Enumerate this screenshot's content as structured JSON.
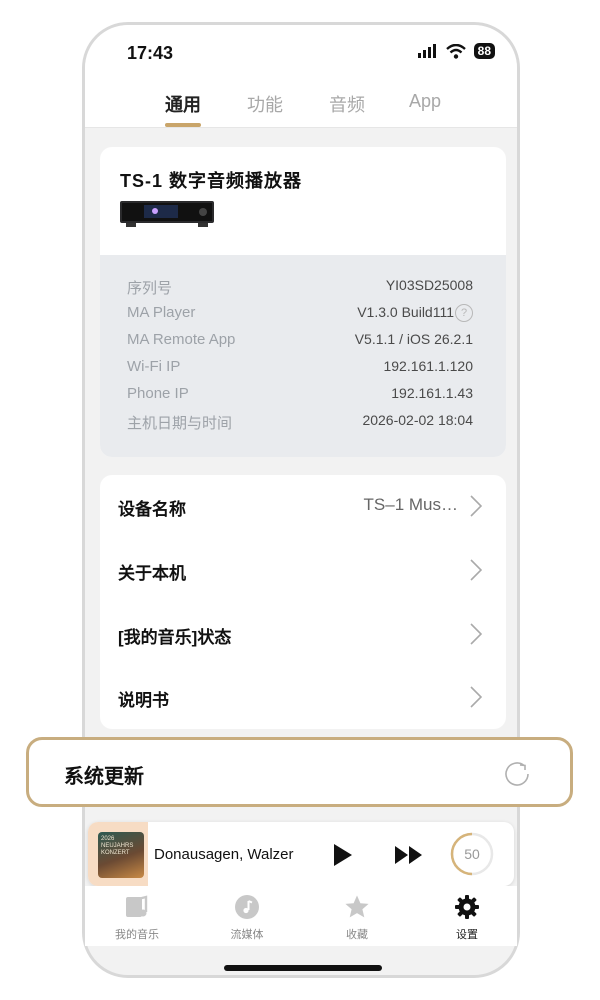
{
  "status_bar": {
    "time": "17:43",
    "battery": "88"
  },
  "tabs": [
    {
      "label": "通用",
      "active": true
    },
    {
      "label": "功能"
    },
    {
      "label": "音频"
    },
    {
      "label": "App"
    }
  ],
  "device": {
    "title": "TS-1 数字音频播放器",
    "info": [
      {
        "label": "序列号",
        "value": "YI03SD25008"
      },
      {
        "label": "MA Player",
        "value": "V1.3.0 Build111"
      },
      {
        "label": "MA Remote App",
        "value": "V5.1.1 / iOS 26.2.1"
      },
      {
        "label": "Wi-Fi IP",
        "value": "192.161.1.120"
      },
      {
        "label": "Phone IP",
        "value": "192.161.1.43"
      },
      {
        "label": "主机日期与时间",
        "value": "2026-02-02 18:04"
      }
    ]
  },
  "menu": [
    {
      "label": "设备名称",
      "value": "TS–1 Mus…"
    },
    {
      "label": "关于本机",
      "value": ""
    },
    {
      "label": "[我的音乐]状态",
      "value": ""
    },
    {
      "label": "说明书",
      "value": ""
    }
  ],
  "system_update": {
    "label": "系统更新"
  },
  "player": {
    "track": "Donausagen, Walzer",
    "timer": "50",
    "album_text": "2026 NEUJAHRS KONZERT"
  },
  "tabbar": [
    {
      "label": "我的音乐",
      "icon": "music-library-icon"
    },
    {
      "label": "流媒体",
      "icon": "music-note-icon"
    },
    {
      "label": "收藏",
      "icon": "star-icon"
    },
    {
      "label": "设置",
      "icon": "gear-icon",
      "active": true
    }
  ],
  "colors": {
    "accent": "#c9a56a",
    "highlight_border": "#c8ad7f",
    "info_bg": "#e9ebee"
  }
}
